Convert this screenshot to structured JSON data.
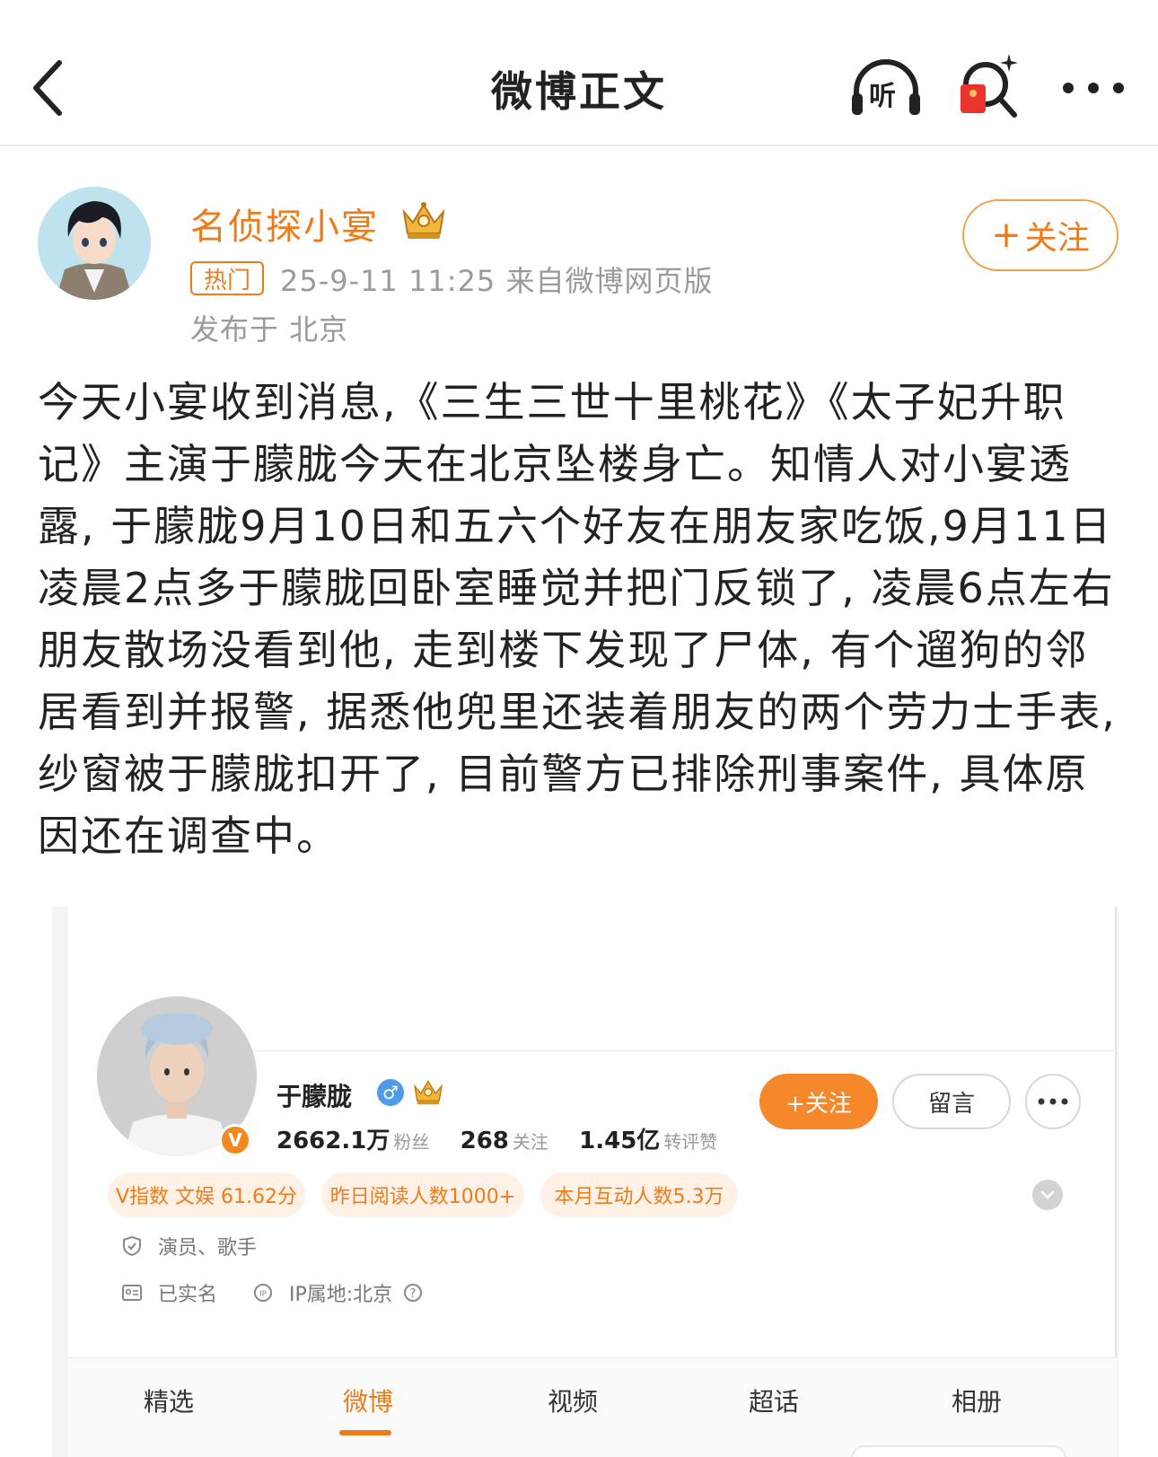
{
  "nav": {
    "title": "微博正文",
    "listen_label": "听"
  },
  "post": {
    "author": "名侦探小宴",
    "follow_label": "关注",
    "follow_plus": "+",
    "hot_badge": "热门",
    "meta": "25-9-11 11:25  来自微博网页版",
    "location": "发布于 北京",
    "body": "今天小宴收到消息,《三生三世十里桃花》《太子妃升职记》主演于朦胧今天在北京坠楼身亡。知情人对小宴透露, 于朦胧9月10日和五六个好友在朋友家吃饭,9月11日凌晨2点多于朦胧回卧室睡觉并把门反锁了, 凌晨6点左右朋友散场没看到他, 走到楼下发现了尸体, 有个遛狗的邻居看到并报警, 据悉他兜里还装着朋友的两个劳力士手表, 纱窗被于朦胧扣开了, 目前警方已排除刑事案件, 具体原因还在调查中。"
  },
  "profile": {
    "name": "于朦胧",
    "v_badge": "V",
    "gender": "♂",
    "stats": [
      {
        "num": "2662.1万",
        "label": "粉丝"
      },
      {
        "num": "268",
        "label": "关注"
      },
      {
        "num": "1.45亿",
        "label": "转评赞"
      }
    ],
    "follow_label": "+关注",
    "message_label": "留言",
    "tags": [
      "V指数 文娱 61.62分",
      "昨日阅读人数1000+",
      "本月互动人数5.3万"
    ],
    "occupation": "演员、歌手",
    "verified": "已实名",
    "ip": "IP属地:北京",
    "tabs": [
      "精选",
      "微博",
      "视频",
      "超话",
      "相册"
    ],
    "active_tab": "微博"
  },
  "colors": {
    "accent": "#ee7b19",
    "follow_fill": "#f4882a",
    "tag_bg": "#fff1e6",
    "gender_blue": "#4e9ce8"
  }
}
